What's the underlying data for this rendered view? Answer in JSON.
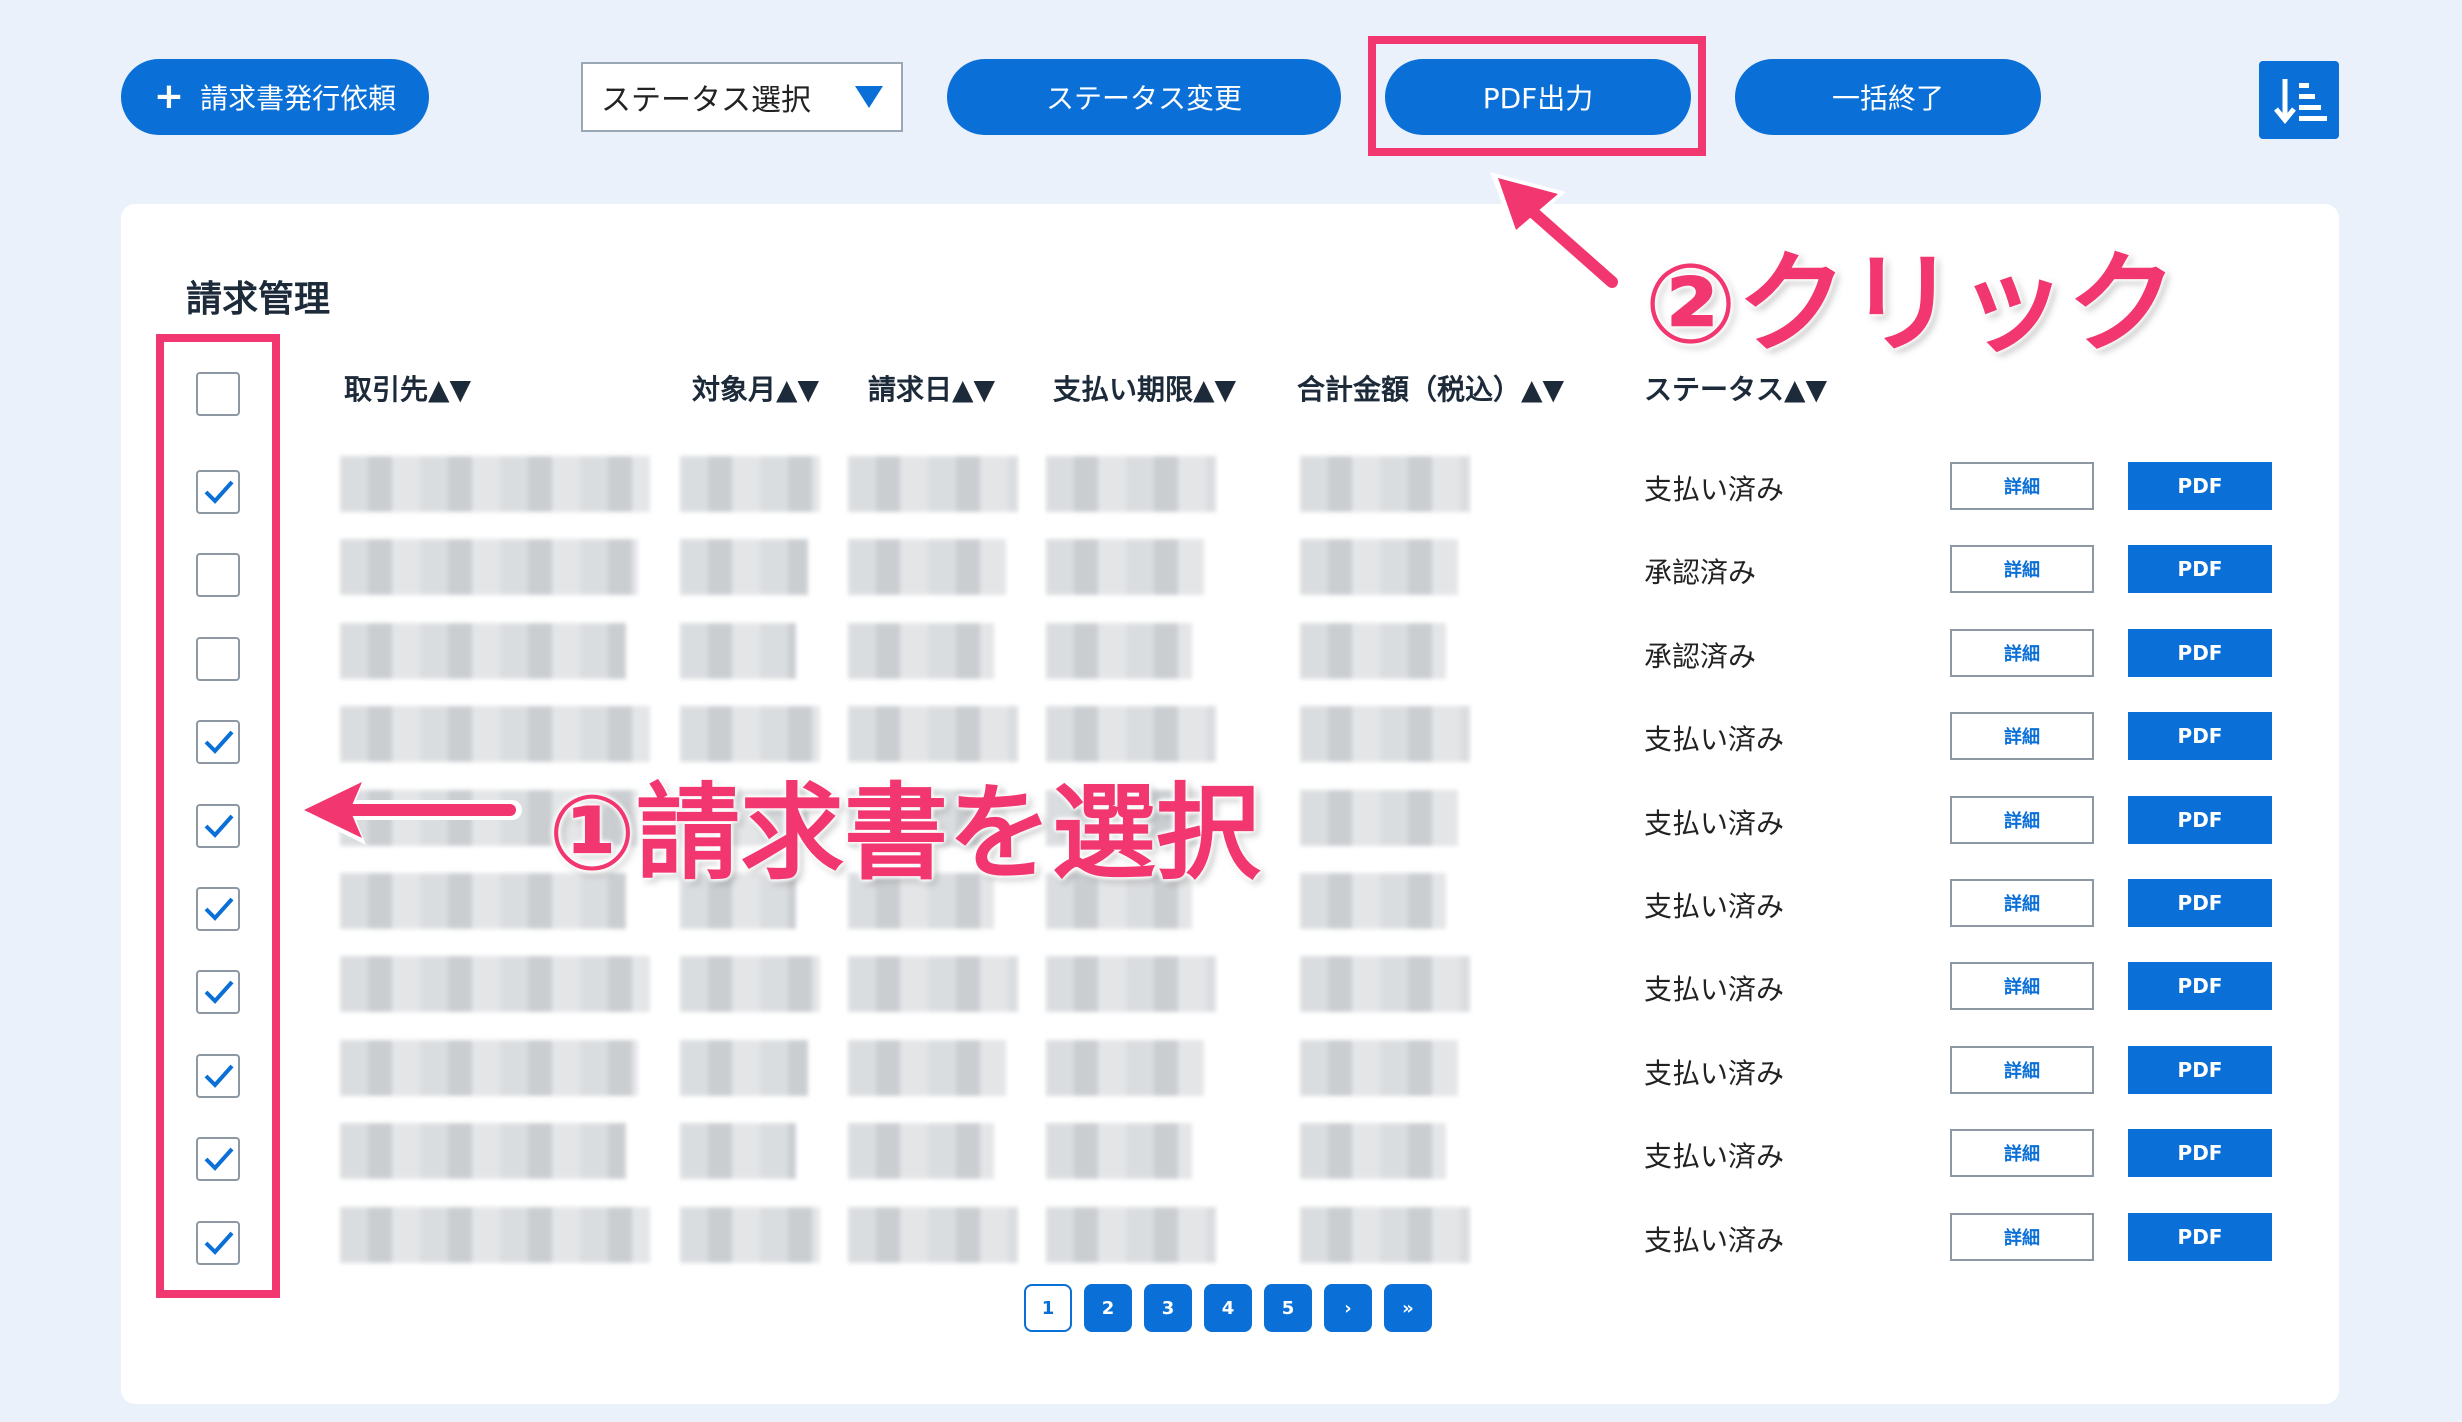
{
  "toolbar": {
    "request_label": "請求書発行依頼",
    "request_icon": "plus-icon",
    "status_select_value": "ステータス選択",
    "status_change_label": "ステータス変更",
    "pdf_output_label": "PDF出力",
    "bulk_end_label": "一括終了",
    "sort_icon": "sort-descending-icon",
    "accent_color": "#0a6fd6"
  },
  "section": {
    "title": "請求管理"
  },
  "table": {
    "headers": [
      "取引先▲▼",
      "対象月▲▼",
      "請求日▲▼",
      "支払い期限▲▼",
      "合計金額（税込）▲▼",
      "ステータス▲▼"
    ],
    "rows": [
      {
        "checked": true,
        "status": "支払い済み",
        "detail": "詳細",
        "pdf": "PDF"
      },
      {
        "checked": false,
        "status": "承認済み",
        "detail": "詳細",
        "pdf": "PDF"
      },
      {
        "checked": false,
        "status": "承認済み",
        "detail": "詳細",
        "pdf": "PDF"
      },
      {
        "checked": true,
        "status": "支払い済み",
        "detail": "詳細",
        "pdf": "PDF"
      },
      {
        "checked": true,
        "status": "支払い済み",
        "detail": "詳細",
        "pdf": "PDF"
      },
      {
        "checked": true,
        "status": "支払い済み",
        "detail": "詳細",
        "pdf": "PDF"
      },
      {
        "checked": true,
        "status": "支払い済み",
        "detail": "詳細",
        "pdf": "PDF"
      },
      {
        "checked": true,
        "status": "支払い済み",
        "detail": "詳細",
        "pdf": "PDF"
      },
      {
        "checked": true,
        "status": "支払い済み",
        "detail": "詳細",
        "pdf": "PDF"
      },
      {
        "checked": true,
        "status": "支払い済み",
        "detail": "詳細",
        "pdf": "PDF"
      }
    ],
    "select_all_checked": false
  },
  "pagination": {
    "pages": [
      "1",
      "2",
      "3",
      "4",
      "5"
    ],
    "next": "›",
    "last": "»",
    "current": "1"
  },
  "annotations": {
    "step1": "①請求書を選択",
    "step2": "②クリック",
    "highlight_color": "#f2366f"
  }
}
